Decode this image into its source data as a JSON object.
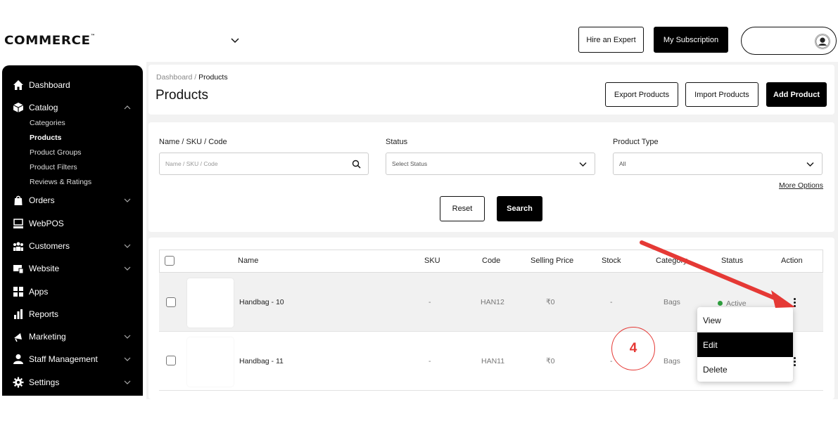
{
  "brand": {
    "logo_text": "COMMERCE",
    "tm": "™"
  },
  "topbar": {
    "hire_label": "Hire an Expert",
    "subscription_label": "My Subscription"
  },
  "sidebar": {
    "items": [
      {
        "label": "Dashboard"
      },
      {
        "label": "Catalog"
      },
      {
        "label": "Orders"
      },
      {
        "label": "WebPOS"
      },
      {
        "label": "Customers"
      },
      {
        "label": "Website"
      },
      {
        "label": "Apps"
      },
      {
        "label": "Reports"
      },
      {
        "label": "Marketing"
      },
      {
        "label": "Staff Management"
      },
      {
        "label": "Settings"
      }
    ],
    "catalog_sub": [
      "Categories",
      "Products",
      "Product Groups",
      "Product Filters",
      "Reviews & Ratings"
    ]
  },
  "header": {
    "breadcrumb_root": "Dashboard",
    "breadcrumb_sep": " / ",
    "breadcrumb_current": "Products",
    "title": "Products",
    "export_label": "Export Products",
    "import_label": "Import Products",
    "add_label": "Add Product"
  },
  "filters": {
    "name_label": "Name / SKU / Code",
    "name_placeholder": "Name / SKU / Code",
    "status_label": "Status",
    "status_value": "Select Status",
    "type_label": "Product Type",
    "type_value": "All",
    "more_options": "More Options",
    "reset_label": "Reset",
    "search_label": "Search"
  },
  "table": {
    "columns": [
      "Name",
      "SKU",
      "Code",
      "Selling Price",
      "Stock",
      "Category",
      "Status",
      "Action"
    ],
    "rows": [
      {
        "name": "Handbag - 10",
        "sku": "-",
        "code": "HAN12",
        "price": "₹0",
        "stock": "-",
        "category": "Bags",
        "status": "Active"
      },
      {
        "name": "Handbag - 11",
        "sku": "-",
        "code": "HAN11",
        "price": "₹0",
        "stock": "-",
        "category": "Bags",
        "status": ""
      }
    ]
  },
  "action_menu": {
    "items": [
      "View",
      "Edit",
      "Delete"
    ]
  },
  "annotation": {
    "step": "4"
  },
  "colors": {
    "accent": "#000000",
    "annotation": "#e53935",
    "active_status": "#2e9e3e"
  }
}
